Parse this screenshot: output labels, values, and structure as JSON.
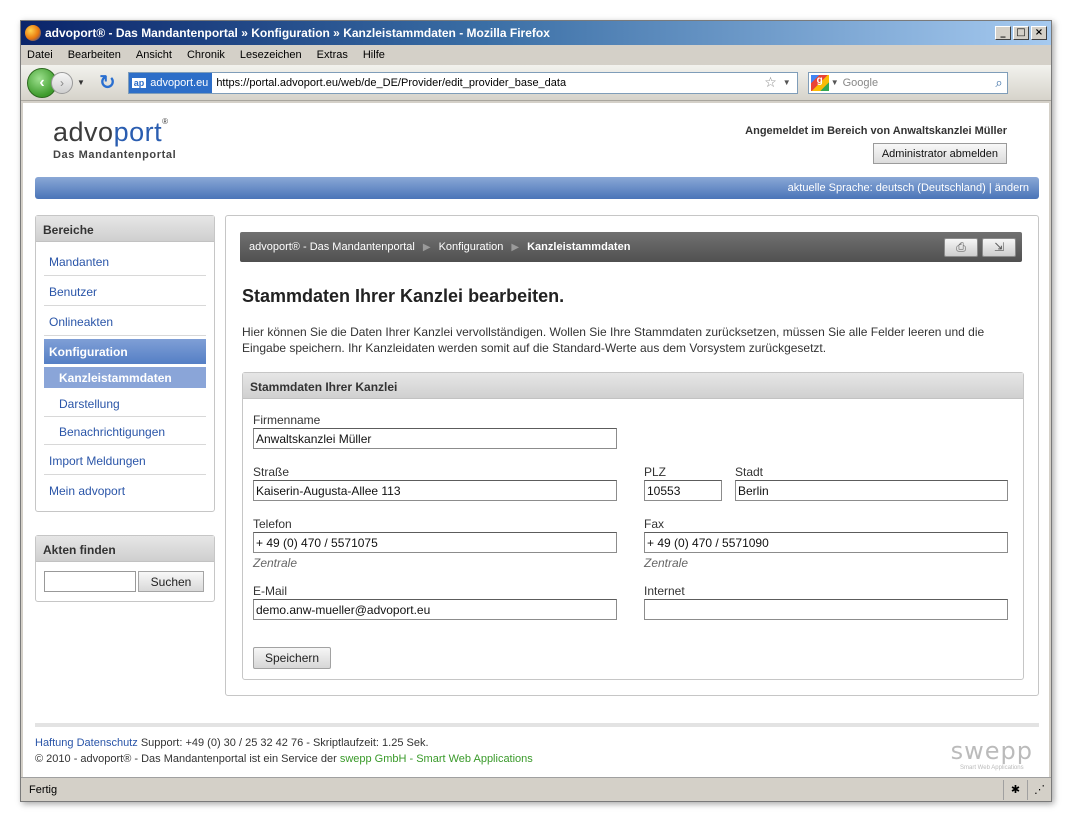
{
  "browser": {
    "title": "advoport® - Das Mandantenportal  »  Konfiguration  »  Kanzleistammdaten - Mozilla Firefox",
    "menu": [
      "Datei",
      "Bearbeiten",
      "Ansicht",
      "Chronik",
      "Lesezeichen",
      "Extras",
      "Hilfe"
    ],
    "site_badge": "advoport.eu",
    "url": "https://portal.advoport.eu/web/de_DE/Provider/edit_provider_base_data",
    "search_placeholder": "Google",
    "status": "Fertig"
  },
  "header": {
    "logo_word_a": "advo",
    "logo_word_b": "port",
    "logo_sub": "Das Mandantenportal",
    "logged_in": "Angemeldet im Bereich von Anwaltskanzlei Müller",
    "logout_label": "Administrator abmelden",
    "language": "aktuelle Sprache: deutsch (Deutschland) | ändern"
  },
  "sidebar": {
    "title": "Bereiche",
    "items": {
      "mandanten": "Mandanten",
      "benutzer": "Benutzer",
      "onlineakten": "Onlineakten",
      "konfiguration": "Konfiguration",
      "kanzleistammdaten": "Kanzleistammdaten",
      "darstellung": "Darstellung",
      "benachrichtigungen": "Benachrichtigungen",
      "import": "Import Meldungen",
      "mein": "Mein advoport"
    },
    "search_title": "Akten finden",
    "search_value": "",
    "search_button": "Suchen"
  },
  "main": {
    "breadcrumb": [
      "advoport® - Das Mandantenportal",
      "Konfiguration",
      "Kanzleistammdaten"
    ],
    "heading": "Stammdaten Ihrer Kanzlei bearbeiten.",
    "intro": "Hier können Sie die Daten Ihrer Kanzlei vervollständigen. Wollen Sie Ihre Stammdaten zurücksetzen, müssen Sie alle Felder leeren und die Eingabe speichern. Ihr Kanzleidaten werden somit auf die Standard-Werte aus dem Vorsystem zurückgesetzt.",
    "form_title": "Stammdaten Ihrer Kanzlei",
    "fields": {
      "firmenname": {
        "label": "Firmenname",
        "value": "Anwaltskanzlei Müller"
      },
      "strasse": {
        "label": "Straße",
        "value": "Kaiserin-Augusta-Allee 113"
      },
      "plz": {
        "label": "PLZ",
        "value": "10553"
      },
      "stadt": {
        "label": "Stadt",
        "value": "Berlin"
      },
      "telefon": {
        "label": "Telefon",
        "value": "+ 49 (0) 470 / 5571075",
        "hint": "Zentrale"
      },
      "fax": {
        "label": "Fax",
        "value": "+ 49 (0) 470 / 5571090",
        "hint": "Zentrale"
      },
      "email": {
        "label": "E-Mail",
        "value": "demo.anw-mueller@advoport.eu"
      },
      "internet": {
        "label": "Internet",
        "value": ""
      }
    },
    "save_button": "Speichern"
  },
  "footer": {
    "haftung": "Haftung",
    "datenschutz": "Datenschutz",
    "support": "Support: +49 (0) 30 / 25 32 42 76 - Skriptlaufzeit: 1.25 Sek.",
    "copyright": "© 2010 - advoport® - Das Mandantenportal ist ein Service der ",
    "swepp_link": "swepp GmbH - Smart Web Applications",
    "swepp_logo": "swepp",
    "swepp_sub": "Smart Web Applications"
  }
}
